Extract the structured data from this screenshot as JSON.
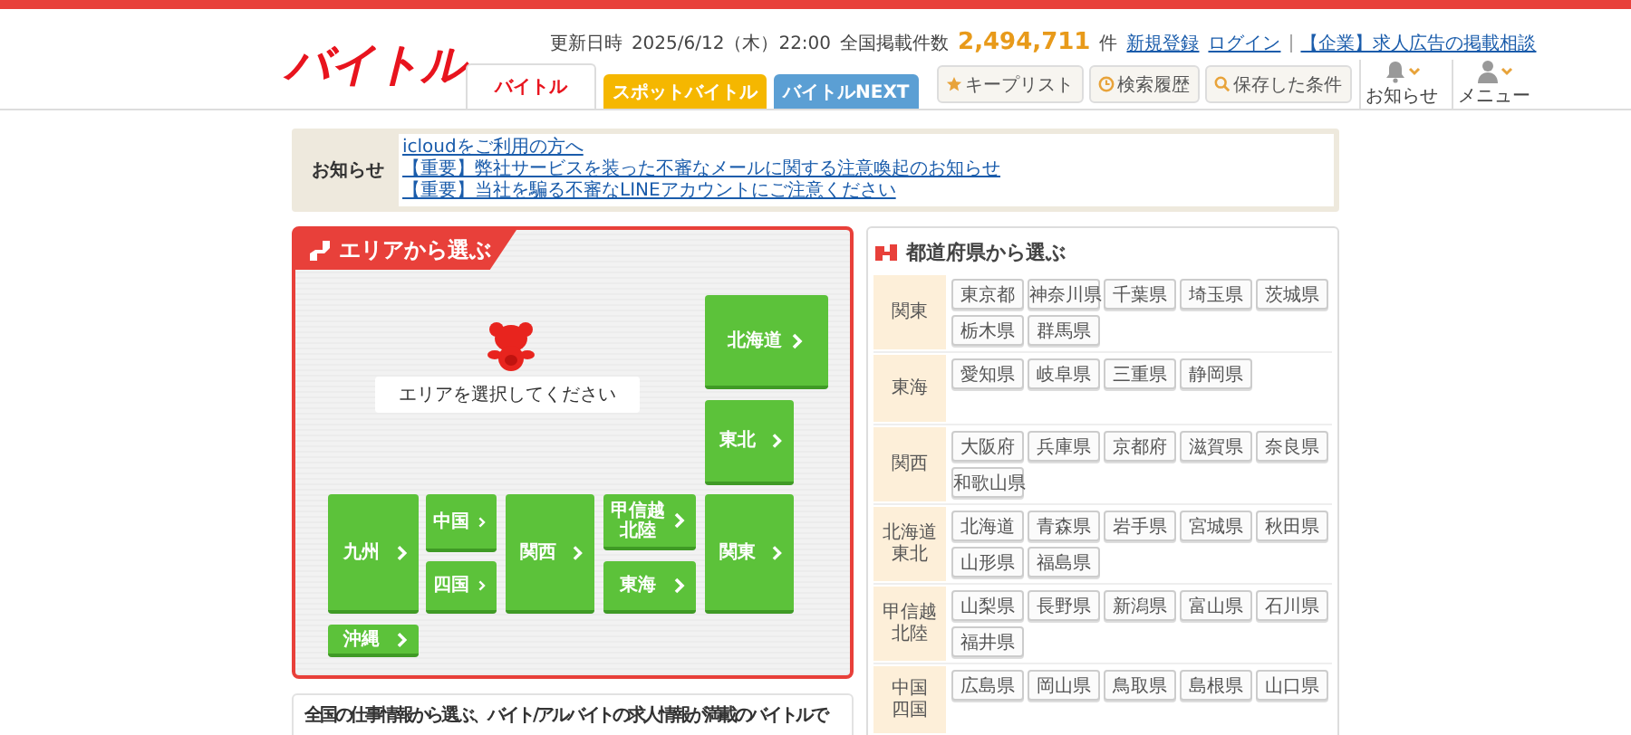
{
  "header": {
    "logo": "バイトル",
    "update_label": "更新日時",
    "update_time": "2025/6/12（木）22:00",
    "count_label": "全国掲載件数",
    "count": "2,494,711",
    "count_unit": "件",
    "links": [
      "新規登録",
      "ログイン",
      "【企業】求人広告の掲載相談"
    ],
    "tabs": [
      {
        "label": "バイトル",
        "kind": "main",
        "selected": true
      },
      {
        "label": "スポットバイトル",
        "kind": "spot",
        "selected": false
      },
      {
        "label": "バイトルNEXT",
        "kind": "next",
        "selected": false
      }
    ],
    "tools": [
      {
        "label": "キープリスト",
        "kind": "star"
      },
      {
        "label": "検索履歴",
        "kind": "history"
      },
      {
        "label": "保存した条件",
        "kind": "search"
      }
    ],
    "menus": [
      {
        "label": "お知らせ",
        "kind": "bell"
      },
      {
        "label": "メニュー",
        "kind": "person"
      }
    ]
  },
  "notice": {
    "title": "お知らせ",
    "links": [
      "icloudをご利用の方へ",
      "【重要】弊社サービスを装った不審なメールに関する注意喚起のお知らせ",
      "【重要】当社を騙る不審なLINEアカウントにご注意ください"
    ]
  },
  "area_map": {
    "title": "エリアから選ぶ",
    "prompt": "エリアを選択してください",
    "regions": [
      {
        "label": "北海道"
      },
      {
        "label": "東北"
      },
      {
        "label": "九州"
      },
      {
        "label": "中国"
      },
      {
        "label": "四国"
      },
      {
        "label": "関西"
      },
      {
        "label": "甲信越北陸"
      },
      {
        "label": "東海"
      },
      {
        "label": "関東"
      },
      {
        "label": "沖縄"
      }
    ]
  },
  "prefectures": {
    "title": "都道府県から選ぶ",
    "groups": [
      {
        "label": "関東",
        "items": [
          "東京都",
          "神奈川県",
          "千葉県",
          "埼玉県",
          "茨城県",
          "栃木県",
          "群馬県"
        ]
      },
      {
        "label": "東海",
        "items": [
          "愛知県",
          "岐阜県",
          "三重県",
          "静岡県"
        ]
      },
      {
        "label": "関西",
        "items": [
          "大阪府",
          "兵庫県",
          "京都府",
          "滋賀県",
          "奈良県",
          "和歌山県"
        ]
      },
      {
        "label": "北海道東北",
        "items": [
          "北海道",
          "青森県",
          "岩手県",
          "宮城県",
          "秋田県",
          "山形県",
          "福島県"
        ]
      },
      {
        "label": "甲信越北陸",
        "items": [
          "山梨県",
          "長野県",
          "新潟県",
          "富山県",
          "石川県",
          "福井県"
        ]
      },
      {
        "label": "中国四国",
        "items": [
          "広島県",
          "岡山県",
          "鳥取県",
          "島根県",
          "山口県"
        ]
      }
    ]
  },
  "intro": {
    "text": "全国の仕事情報から選ぶ、バイト/アルバイトの求人情報が満載のバイトルで"
  }
}
